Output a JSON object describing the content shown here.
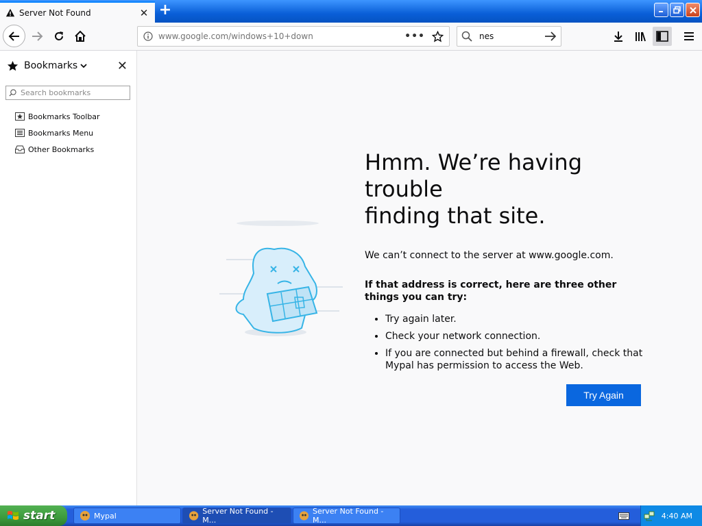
{
  "tab": {
    "title": "Server Not Found"
  },
  "navbar": {
    "url": "www.google.com/windows+10+down",
    "search_value": "nes"
  },
  "sidebar": {
    "title": "Bookmarks",
    "search_placeholder": "Search bookmarks",
    "items": [
      {
        "label": "Bookmarks Toolbar",
        "icon": "bookmarks-toolbar-icon"
      },
      {
        "label": "Bookmarks Menu",
        "icon": "bookmarks-menu-icon"
      },
      {
        "label": "Other Bookmarks",
        "icon": "other-bookmarks-icon"
      }
    ]
  },
  "error": {
    "title_line1": "Hmm. We’re having trouble",
    "title_line2": "finding that site.",
    "message": "We can’t connect to the server at www.google.com.",
    "suggestion_heading": "If that address is correct, here are three other things you can try:",
    "suggestions": [
      "Try again later.",
      "Check your network connection.",
      "If you are connected but behind a firewall, check that Mypal has permission to access the Web."
    ],
    "button_label": "Try Again"
  },
  "taskbar": {
    "start_label": "start",
    "tasks": [
      {
        "label": "Mypal"
      },
      {
        "label": "Server Not Found - M..."
      },
      {
        "label": "Server Not Found - M..."
      }
    ],
    "clock": "4:40 AM"
  },
  "colors": {
    "accent": "#0a67df",
    "titlebar": "#0a5fd8",
    "taskbar": "#245edb",
    "start": "#3c9a3c"
  }
}
